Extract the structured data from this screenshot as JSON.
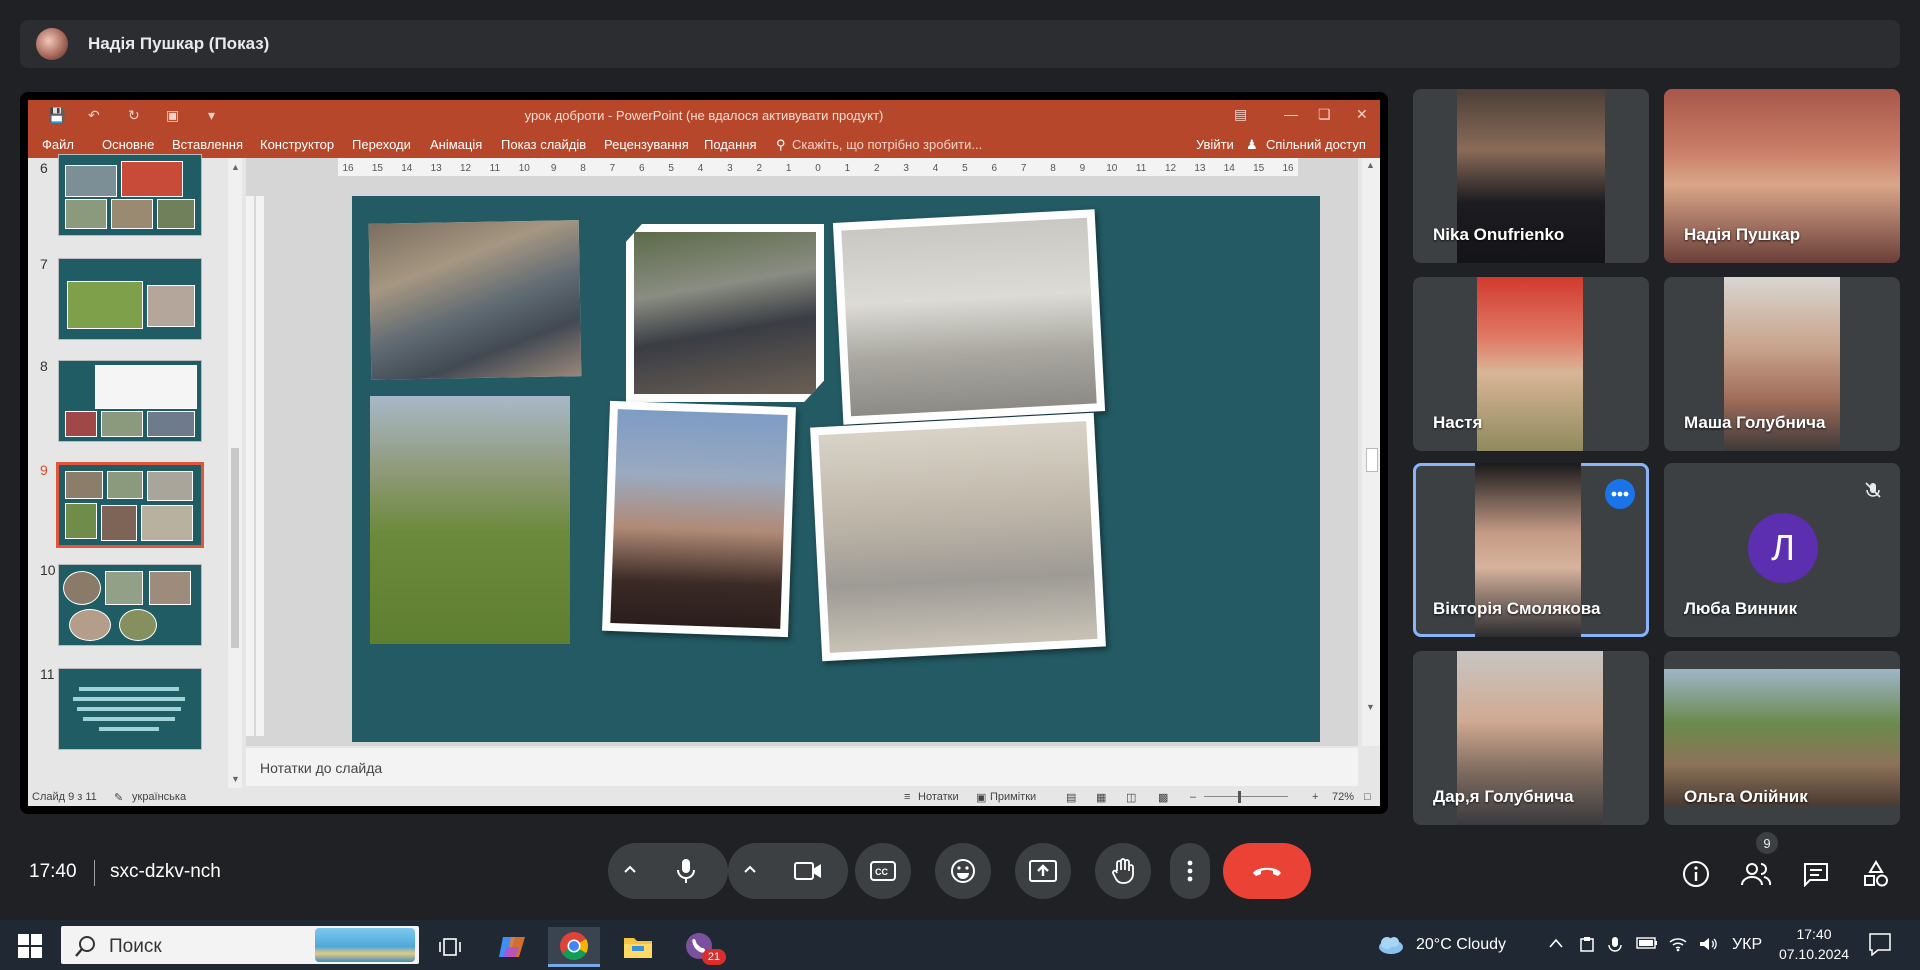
{
  "presenter_bar": {
    "name": "Надія Пушкар (Показ)"
  },
  "powerpoint": {
    "window_title": "урок доброти - PowerPoint (не вдалося активувати продукт)",
    "menu": [
      "Файл",
      "Основне",
      "Вставлення",
      "Конструктор",
      "Переходи",
      "Анімація",
      "Показ слайдів",
      "Рецензування",
      "Подання"
    ],
    "tell_me": "Скажіть, що потрібно зробити...",
    "sign_in": "Увійти",
    "share": "Спільний доступ",
    "thumbnail_numbers": [
      "6",
      "7",
      "8",
      "9",
      "10",
      "11"
    ],
    "selected_slide": "9",
    "ruler_labels": [
      "16",
      "15",
      "14",
      "13",
      "12",
      "11",
      "10",
      "9",
      "8",
      "7",
      "6",
      "5",
      "4",
      "3",
      "2",
      "1",
      "0",
      "1",
      "2",
      "3",
      "4",
      "5",
      "6",
      "7",
      "8",
      "9",
      "10",
      "11",
      "12",
      "13",
      "14",
      "15",
      "16"
    ],
    "notes_placeholder": "Нотатки до слайда",
    "status": {
      "slide_count": "Слайд 9 з 11",
      "language": "українська",
      "notes_btn": "Нотатки",
      "comments_btn": "Примітки",
      "zoom": "72%"
    }
  },
  "participants": [
    {
      "name": "Nika Onufrienko"
    },
    {
      "name": "Надія Пушкар"
    },
    {
      "name": "Настя"
    },
    {
      "name": "Маша Голубнича"
    },
    {
      "name": "Вікторія Смолякова"
    },
    {
      "name": "Люба Винник",
      "initial": "Л",
      "avatar_color": "#5b2fb0"
    },
    {
      "name": "Дар,я Голубнича"
    },
    {
      "name": "Ольга Олійник"
    }
  ],
  "call": {
    "time": "17:40",
    "meeting_code": "sxc-dzkv-nch",
    "participants_badge": "9",
    "end_call_color": "#ea4335"
  },
  "taskbar": {
    "search_placeholder": "Поиск",
    "viber_badge": "21",
    "weather": "20°C  Cloudy",
    "language": "УКР",
    "time": "17:40",
    "date": "07.10.2024"
  }
}
